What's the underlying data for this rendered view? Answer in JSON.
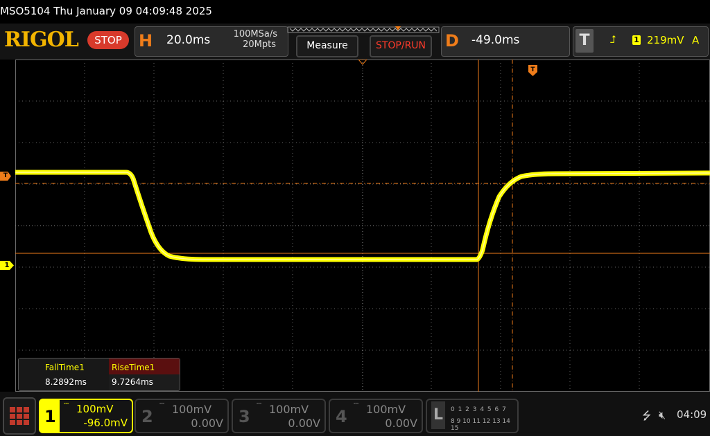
{
  "window_title": "MSO5104  Thu January 09 04:09:48 2025",
  "header": {
    "logo": "RIGOL",
    "run_state": "STOP",
    "h_letter": "H",
    "timebase": "20.0ms",
    "sample_rate": "100MSa/s",
    "memory_depth": "20Mpts",
    "measure_label": "Measure",
    "stop_run_label": "STOP/RUN",
    "d_letter": "D",
    "delay": "-49.0ms",
    "t_letter": "T",
    "trigger_channel": "1",
    "trigger_level": "219mV",
    "trigger_mode": "A"
  },
  "markers": {
    "trigger_level_marker": "T",
    "channel1_marker": "1"
  },
  "measurements": [
    {
      "label": "FallTime1",
      "value": "8.2892ms"
    },
    {
      "label": "RiseTime1",
      "value": "9.7264ms"
    }
  ],
  "channels": [
    {
      "num": "1",
      "scale": "100mV",
      "offset": "-96.0mV",
      "active": true
    },
    {
      "num": "2",
      "scale": "100mV",
      "offset": "0.00V",
      "active": false
    },
    {
      "num": "3",
      "scale": "100mV",
      "offset": "0.00V",
      "active": false
    },
    {
      "num": "4",
      "scale": "100mV",
      "offset": "0.00V",
      "active": false
    }
  ],
  "logic": {
    "letter": "L",
    "row1": "0 1 2 3   4 5 6 7",
    "row2": "8 9 10 11  12 13 14 15"
  },
  "status": {
    "time": "04:09"
  },
  "colors": {
    "channel1": "#ffff00",
    "accent": "#f07d1a",
    "stop": "#d83a2b"
  }
}
